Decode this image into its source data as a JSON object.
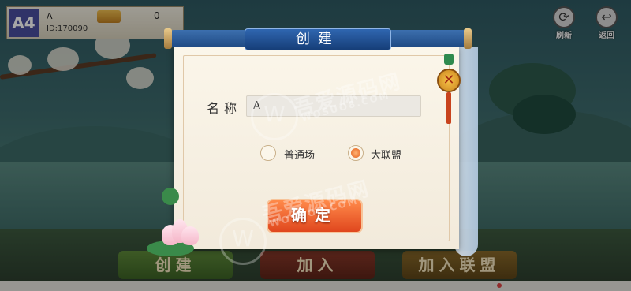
{
  "user": {
    "avatar_text": "A4",
    "name": "A",
    "id": "ID:170090",
    "coin_value": "0"
  },
  "top_buttons": {
    "refresh_label": "刷新",
    "back_label": "返回"
  },
  "bottom_buttons": {
    "create_label": "创建",
    "join_label": "加入",
    "join_league_label": "加入联盟"
  },
  "dialog": {
    "title": "创建",
    "name_label": "名称",
    "name_value": "A",
    "options": [
      {
        "label": "普通场",
        "checked": false
      },
      {
        "label": "大联盟",
        "checked": true
      }
    ],
    "confirm_label": "确定"
  },
  "watermark": {
    "text": "吾爱源码网",
    "url": "WOSUO8.COM"
  },
  "colors": {
    "accent": "#e2601e",
    "title_plate": "#1f4a83",
    "paper": "#fbf6ea"
  }
}
